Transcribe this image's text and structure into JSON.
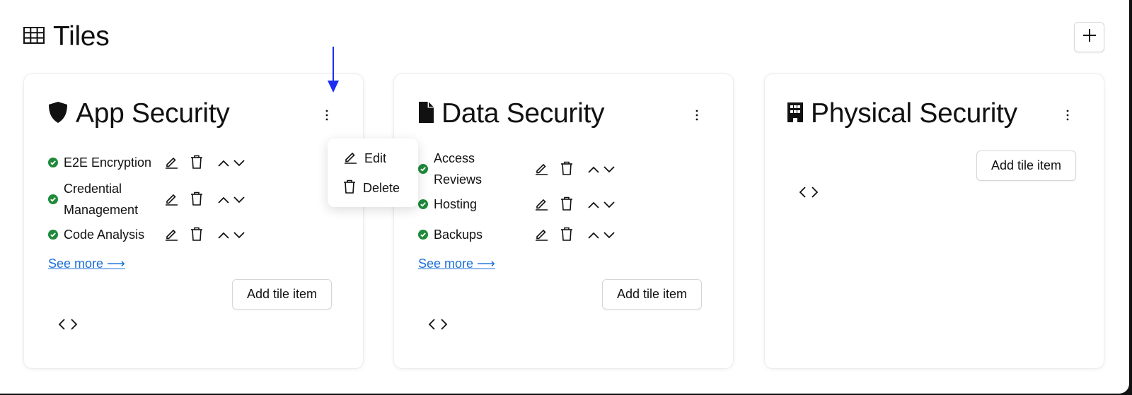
{
  "page": {
    "title": "Tiles",
    "title_icon": "table-icon",
    "add_button_icon": "plus-icon"
  },
  "colors": {
    "check": "#1e8a3a",
    "link": "#1a6fd8",
    "annotation_arrow": "#1b2ef2"
  },
  "tiles": [
    {
      "title": "App Security",
      "icon": "shield-icon",
      "items": [
        {
          "label": "E2E Encryption"
        },
        {
          "label": "Credential Management"
        },
        {
          "label": "Code Analysis"
        }
      ],
      "see_more": "See more ⟶",
      "add_item_label": "Add tile item"
    },
    {
      "title": "Data Security",
      "icon": "file-icon",
      "items": [
        {
          "label": "Access Reviews"
        },
        {
          "label": "Hosting"
        },
        {
          "label": "Backups"
        }
      ],
      "see_more": "See more ⟶",
      "add_item_label": "Add tile item"
    },
    {
      "title": "Physical Security",
      "icon": "building-icon",
      "items": [],
      "add_item_label": "Add tile item"
    }
  ],
  "context_menu": {
    "items": [
      {
        "label": "Edit",
        "icon": "pencil-icon"
      },
      {
        "label": "Delete",
        "icon": "trash-icon"
      }
    ]
  }
}
